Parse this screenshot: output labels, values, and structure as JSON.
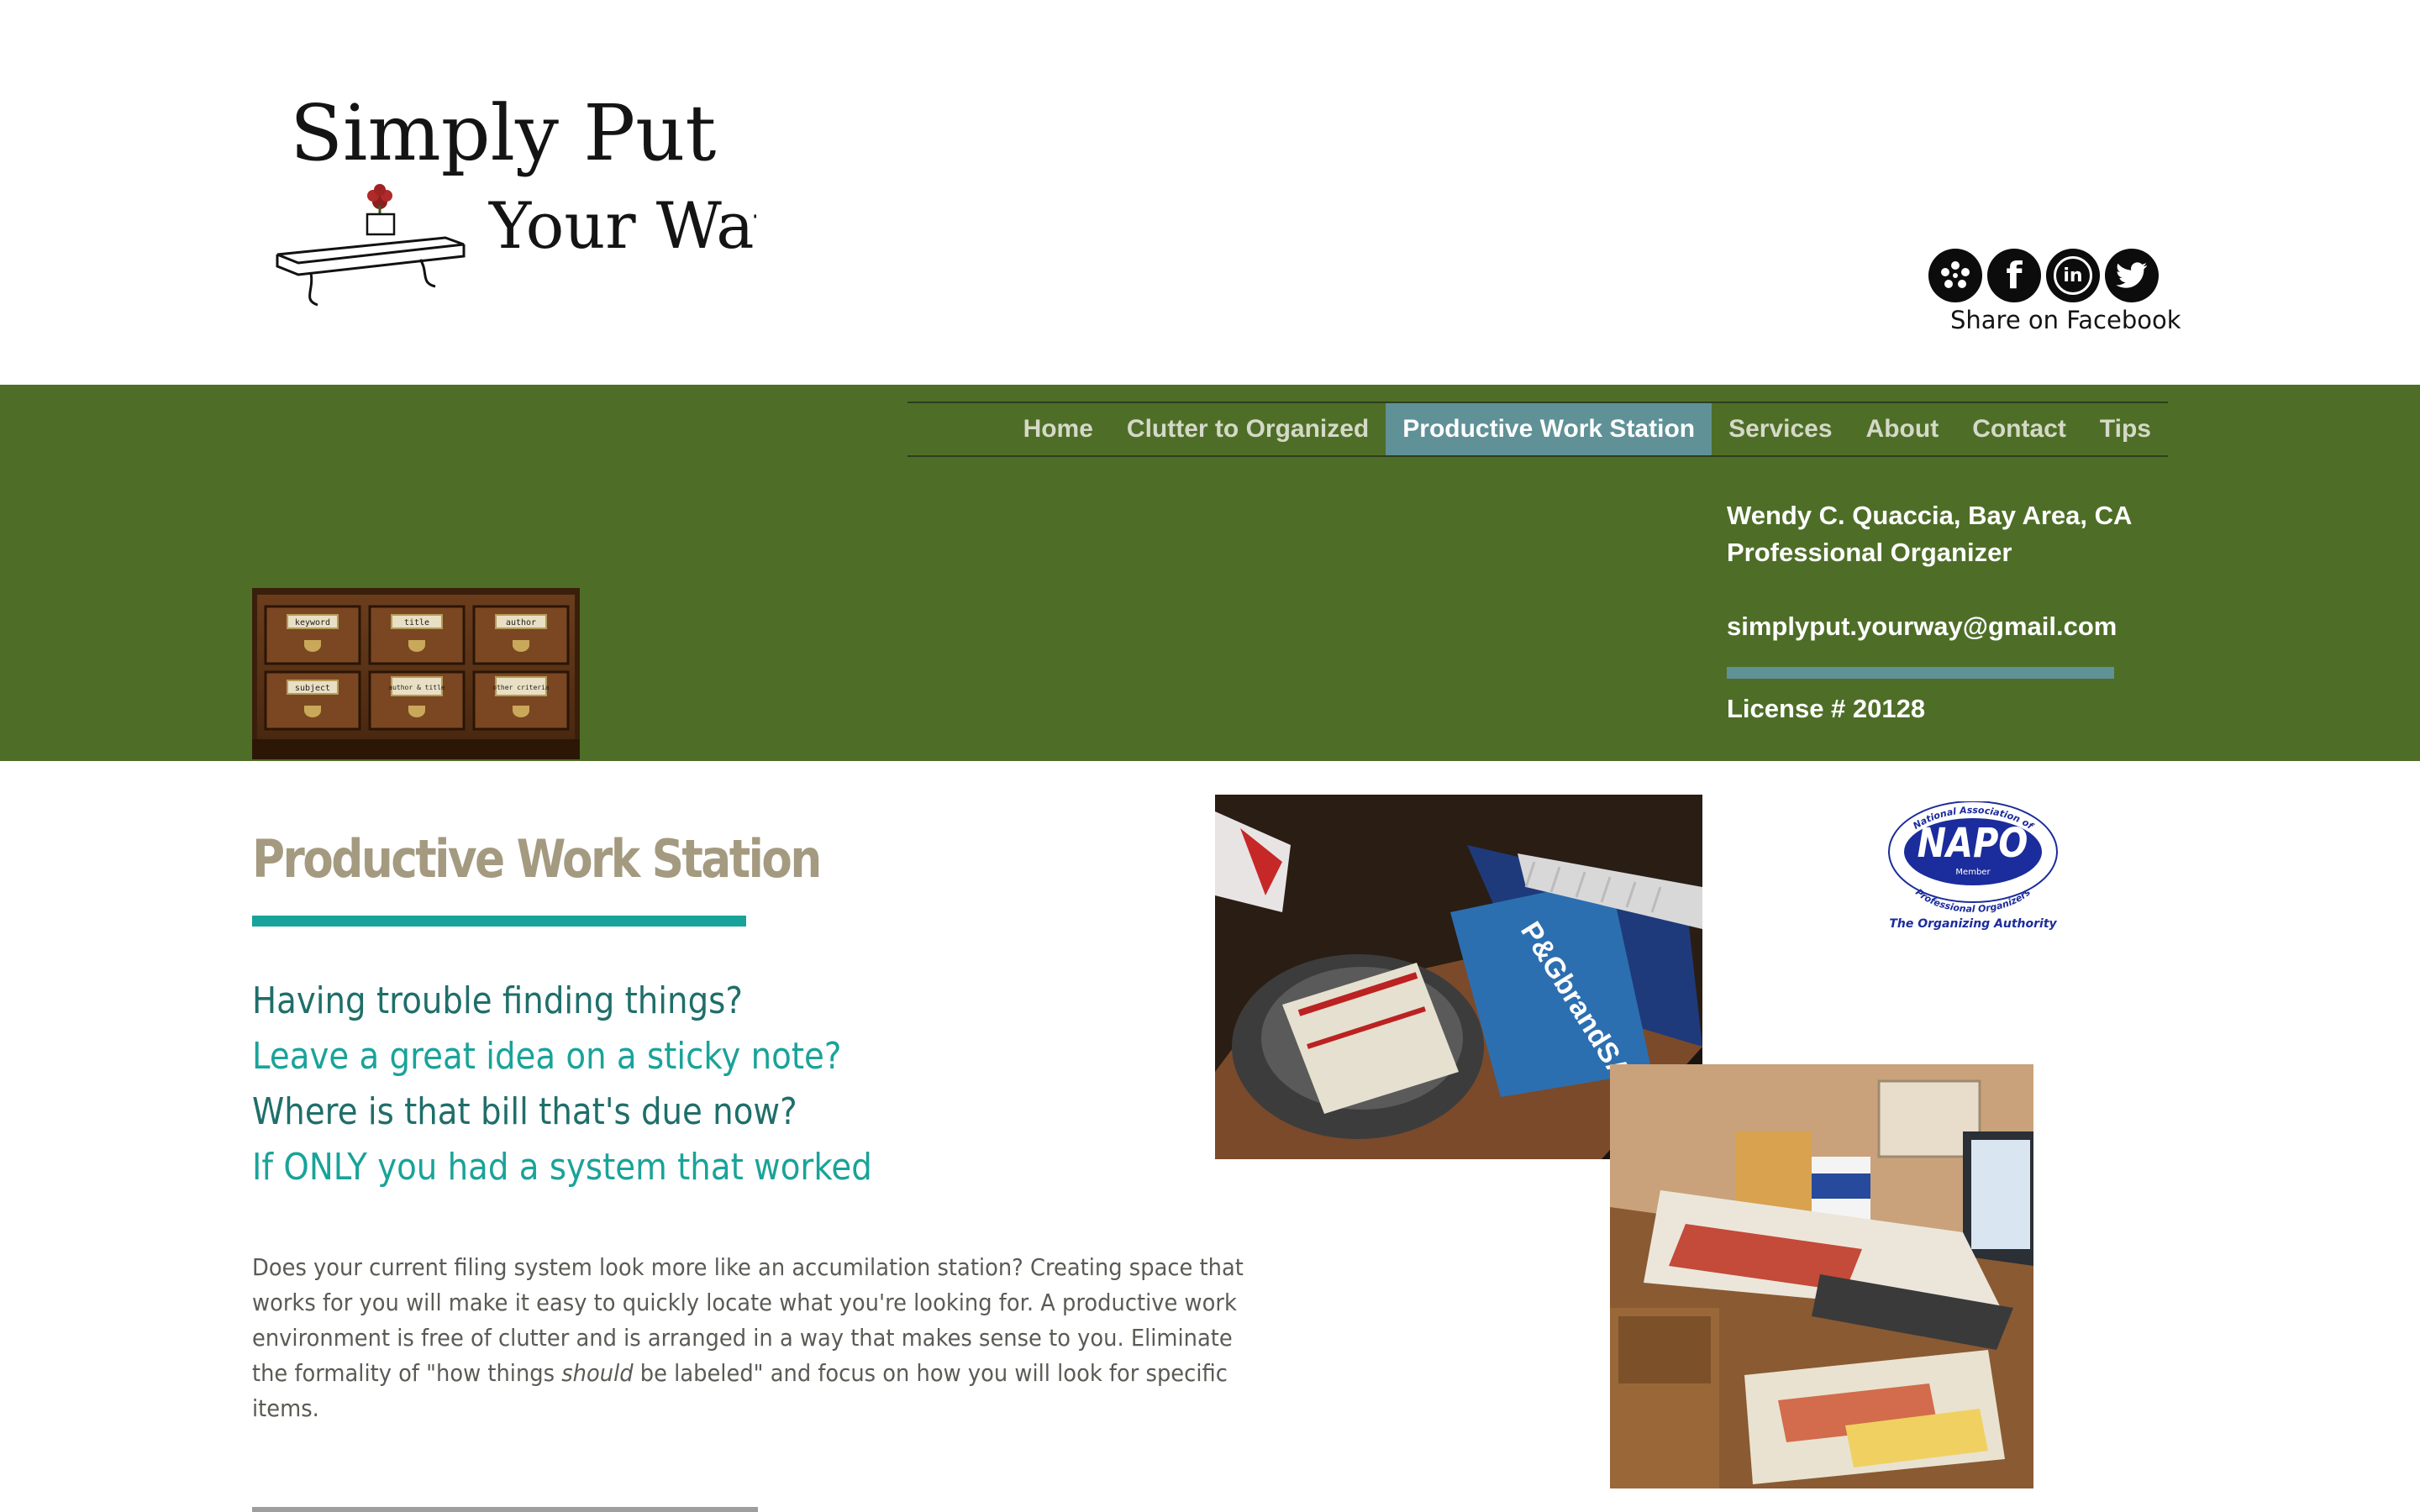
{
  "logo": {
    "line1": "Simply Put",
    "line2": "Your Way"
  },
  "social": {
    "icons": [
      "yelp-icon",
      "facebook-icon",
      "linkedin-icon",
      "twitter-icon"
    ],
    "share_label": "Share on Facebook"
  },
  "nav": {
    "items": [
      {
        "label": "Home"
      },
      {
        "label": "Clutter to Organized"
      },
      {
        "label": "Productive Work Station"
      },
      {
        "label": "Services"
      },
      {
        "label": "About"
      },
      {
        "label": "Contact"
      },
      {
        "label": "Tips"
      }
    ],
    "active": "Productive Work Station"
  },
  "drawers": {
    "labels": [
      "keyword",
      "title",
      "author",
      "subject",
      "author & title",
      "other criteria"
    ]
  },
  "contact": {
    "name": "Wendy C. Quaccia, Bay Area, CA",
    "role": "Professional Organizer",
    "email": "simplyput.yourway@gmail.com",
    "license": "License # 20128"
  },
  "main": {
    "title": "Productive Work Station",
    "taglines": [
      "Having trouble finding things?",
      "Leave a great idea on a sticky note?",
      "Where is that bill that's due now?",
      "If ONLY you had a system that worked"
    ],
    "body_before": "Does your current filing system look more like an accumilation station? Creating space that works for you will make it easy to quickly locate what you're looking for. A productive work environment is free of clutter and is arranged in a way that makes sense to you. Eliminate the formality of \"how things ",
    "body_emphasis": "should",
    "body_after": " be labeled\" and focus on how you will look for specific items."
  },
  "napo": {
    "arc_top": "National Association of",
    "badge": "NAPO",
    "member": "Member",
    "arc_bottom": "Professional Organizers",
    "tagline": "The Organizing Authority"
  },
  "colors": {
    "band_green": "#4e6e27",
    "nav_active": "#5f9197",
    "title_gray": "#a49a80",
    "accent_teal": "#17a39a",
    "tagline_dark": "#1f6e6a",
    "tagline_light": "#19a399"
  }
}
